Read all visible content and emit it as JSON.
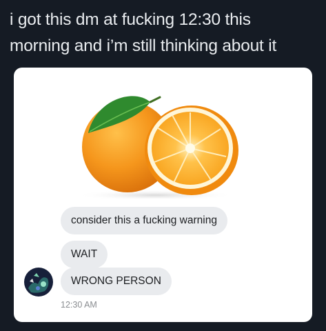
{
  "tweet": {
    "text_line1": "i got this dm at fucking 12:30 this",
    "text_line2": "morning and i’m still thinking about it"
  },
  "chat": {
    "image_description_icon": "orange-image",
    "messages": [
      "consider this a fucking warning",
      "WAIT",
      "WRONG PERSON"
    ],
    "timestamp": "12:30 AM"
  },
  "colors": {
    "page_background": "#151b24",
    "card_background": "#ffffff",
    "bubble_background": "#e9ebee",
    "orange": "#f5961c",
    "leaf": "#2f8a2e"
  }
}
